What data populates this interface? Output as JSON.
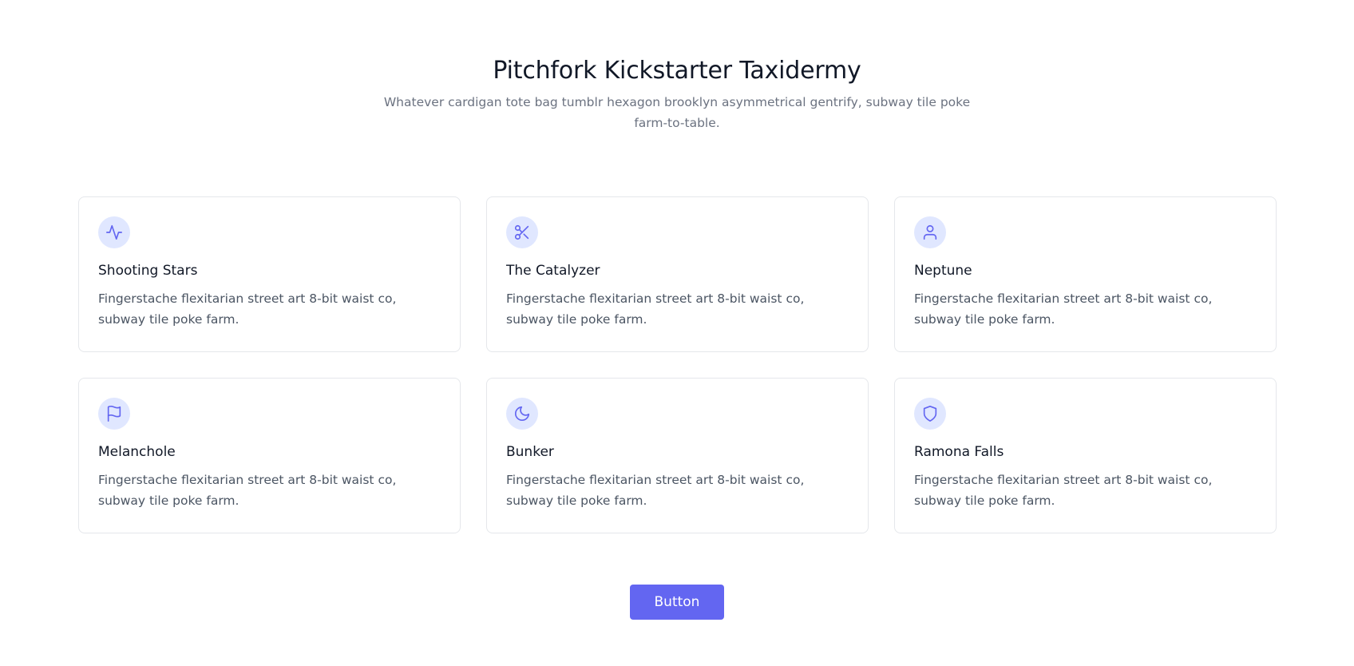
{
  "header": {
    "title": "Pitchfork Kickstarter Taxidermy",
    "subtitle": "Whatever cardigan tote bag tumblr hexagon brooklyn asymmetrical gentrify, subway tile poke farm-to-table."
  },
  "features": [
    {
      "title": "Shooting Stars",
      "text": "Fingerstache flexitarian street art 8-bit waist co, subway tile poke farm.",
      "icon": "activity-icon"
    },
    {
      "title": "The Catalyzer",
      "text": "Fingerstache flexitarian street art 8-bit waist co, subway tile poke farm.",
      "icon": "scissors-icon"
    },
    {
      "title": "Neptune",
      "text": "Fingerstache flexitarian street art 8-bit waist co, subway tile poke farm.",
      "icon": "user-icon"
    },
    {
      "title": "Melanchole",
      "text": "Fingerstache flexitarian street art 8-bit waist co, subway tile poke farm.",
      "icon": "flag-icon"
    },
    {
      "title": "Bunker",
      "text": "Fingerstache flexitarian street art 8-bit waist co, subway tile poke farm.",
      "icon": "moon-icon"
    },
    {
      "title": "Ramona Falls",
      "text": "Fingerstache flexitarian street art 8-bit waist co, subway tile poke farm.",
      "icon": "shield-icon"
    }
  ],
  "cta": {
    "button_label": "Button"
  },
  "colors": {
    "accent": "#6366f1",
    "icon_bg": "#e0e7ff",
    "border": "#e5e7eb"
  }
}
